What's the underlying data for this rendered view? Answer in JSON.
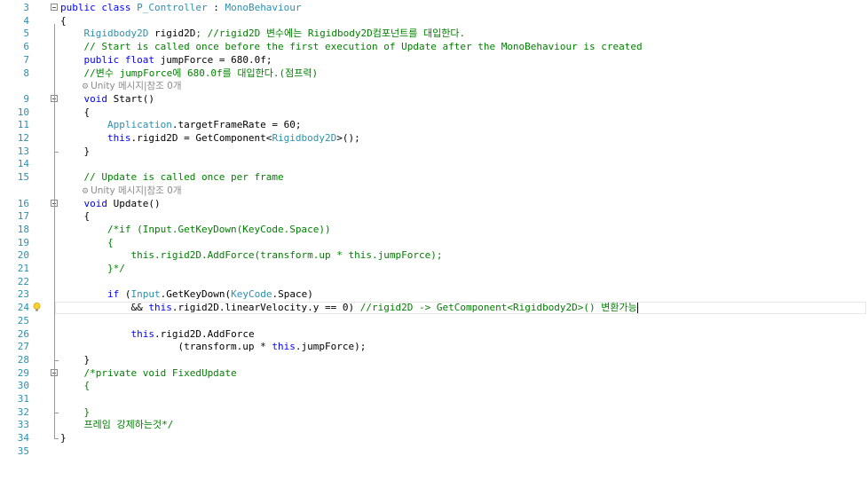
{
  "editor": {
    "current_line": 24,
    "lines": [
      {
        "n": "3",
        "segments": [
          {
            "t": "public class ",
            "c": "kw"
          },
          {
            "t": "P_Controller",
            "c": "ty"
          },
          {
            "t": " : ",
            "c": "nm"
          },
          {
            "t": "MonoBehaviour",
            "c": "ty"
          }
        ]
      },
      {
        "n": "4",
        "segments": [
          {
            "t": "{",
            "c": "nm"
          }
        ]
      },
      {
        "n": "5",
        "segments": [
          {
            "t": "    ",
            "c": "nm"
          },
          {
            "t": "Rigidbody2D",
            "c": "ty"
          },
          {
            "t": " rigid2D",
            "c": "nm"
          },
          {
            "t": "; //rigid2D 변수에는 Rigidbody2D컴포넌트를 대입한다.",
            "c": "cm"
          }
        ]
      },
      {
        "n": "6",
        "segments": [
          {
            "t": "    // Start is called once before the first execution of Update after the MonoBehaviour is created",
            "c": "cm"
          }
        ]
      },
      {
        "n": "7",
        "segments": [
          {
            "t": "    ",
            "c": "nm"
          },
          {
            "t": "public float",
            "c": "kw"
          },
          {
            "t": " jumpForce = 680.0f;",
            "c": "nm"
          }
        ]
      },
      {
        "n": "8",
        "segments": [
          {
            "t": "    //변수 jumpForce에 680.0f를 대입한다.(점프력)",
            "c": "cm"
          }
        ]
      },
      {
        "n": "",
        "lens": "Unity 메시지|참조 0개"
      },
      {
        "n": "9",
        "segments": [
          {
            "t": "    ",
            "c": "nm"
          },
          {
            "t": "void",
            "c": "kw"
          },
          {
            "t": " Start()",
            "c": "nm"
          }
        ]
      },
      {
        "n": "10",
        "segments": [
          {
            "t": "    {",
            "c": "nm"
          }
        ]
      },
      {
        "n": "11",
        "segments": [
          {
            "t": "        ",
            "c": "nm"
          },
          {
            "t": "Application",
            "c": "ty"
          },
          {
            "t": ".targetFrameRate = 60;",
            "c": "nm"
          }
        ]
      },
      {
        "n": "12",
        "segments": [
          {
            "t": "        ",
            "c": "nm"
          },
          {
            "t": "this",
            "c": "kw"
          },
          {
            "t": ".rigid2D = GetComponent<",
            "c": "nm"
          },
          {
            "t": "Rigidbody2D",
            "c": "ty"
          },
          {
            "t": ">();",
            "c": "nm"
          }
        ]
      },
      {
        "n": "13",
        "segments": [
          {
            "t": "    }",
            "c": "nm"
          }
        ]
      },
      {
        "n": "14",
        "segments": []
      },
      {
        "n": "15",
        "segments": [
          {
            "t": "    // Update is called once per frame",
            "c": "cm"
          }
        ]
      },
      {
        "n": "",
        "lens": "Unity 메시지|참조 0개"
      },
      {
        "n": "16",
        "segments": [
          {
            "t": "    ",
            "c": "nm"
          },
          {
            "t": "void",
            "c": "kw"
          },
          {
            "t": " Update()",
            "c": "nm"
          }
        ]
      },
      {
        "n": "17",
        "segments": [
          {
            "t": "    {",
            "c": "nm"
          }
        ]
      },
      {
        "n": "18",
        "segments": [
          {
            "t": "        /*if (Input.GetKeyDown(KeyCode.Space))",
            "c": "cm"
          }
        ]
      },
      {
        "n": "19",
        "segments": [
          {
            "t": "        {",
            "c": "cm"
          }
        ]
      },
      {
        "n": "20",
        "segments": [
          {
            "t": "            this.rigid2D.AddForce(transform.up * this.jumpForce);",
            "c": "cm"
          }
        ]
      },
      {
        "n": "21",
        "segments": [
          {
            "t": "        }*/",
            "c": "cm"
          }
        ]
      },
      {
        "n": "22",
        "segments": []
      },
      {
        "n": "23",
        "segments": [
          {
            "t": "        ",
            "c": "nm"
          },
          {
            "t": "if",
            "c": "kw"
          },
          {
            "t": " (",
            "c": "nm"
          },
          {
            "t": "Input",
            "c": "ty"
          },
          {
            "t": ".GetKeyDown(",
            "c": "nm"
          },
          {
            "t": "KeyCode",
            "c": "ty"
          },
          {
            "t": ".Space)",
            "c": "nm"
          }
        ]
      },
      {
        "n": "24",
        "segments": [
          {
            "t": "            && ",
            "c": "nm"
          },
          {
            "t": "this",
            "c": "kw"
          },
          {
            "t": ".rigid2D.linearVelocity.y == 0) ",
            "c": "nm"
          },
          {
            "t": "//rigid2D -> GetComponent<Rigidbody2D>() 변환가능",
            "c": "cm"
          }
        ]
      },
      {
        "n": "25",
        "segments": []
      },
      {
        "n": "26",
        "segments": [
          {
            "t": "            ",
            "c": "nm"
          },
          {
            "t": "this",
            "c": "kw"
          },
          {
            "t": ".rigid2D.AddForce",
            "c": "nm"
          }
        ]
      },
      {
        "n": "27",
        "segments": [
          {
            "t": "                    (transform.up * ",
            "c": "nm"
          },
          {
            "t": "this",
            "c": "kw"
          },
          {
            "t": ".jumpForce);",
            "c": "nm"
          }
        ]
      },
      {
        "n": "28",
        "segments": [
          {
            "t": "    }",
            "c": "nm"
          }
        ]
      },
      {
        "n": "29",
        "segments": [
          {
            "t": "    /*private void FixedUpdate",
            "c": "cm"
          }
        ]
      },
      {
        "n": "30",
        "segments": [
          {
            "t": "    {",
            "c": "cm"
          }
        ]
      },
      {
        "n": "31",
        "segments": []
      },
      {
        "n": "32",
        "segments": [
          {
            "t": "    }",
            "c": "cm"
          }
        ]
      },
      {
        "n": "33",
        "segments": [
          {
            "t": "    프레임 강제하는것*/",
            "c": "cm"
          }
        ]
      },
      {
        "n": "34",
        "segments": [
          {
            "t": "}",
            "c": "nm"
          }
        ]
      },
      {
        "n": "35",
        "segments": []
      }
    ]
  },
  "icons": {
    "fold": "collapse-icon",
    "lens": "unity-icon",
    "bulb": "lightbulb-icon"
  },
  "colors": {
    "keyword": "#0000ff",
    "type": "#2b91af",
    "comment": "#008000",
    "line_number": "#2b91af"
  }
}
